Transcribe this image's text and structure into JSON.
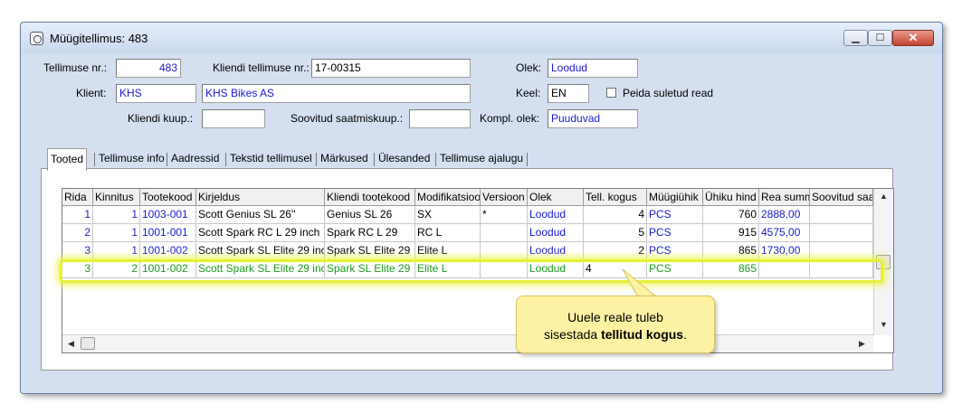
{
  "window": {
    "title": "Müügitellimus: 483"
  },
  "form": {
    "order_no_label": "Tellimuse nr.:",
    "order_no": "483",
    "client_order_label": "Kliendi tellimuse nr.:",
    "client_order": "17-00315",
    "status_label": "Olek:",
    "status": "Loodud",
    "client_label": "Klient:",
    "client_code": "KHS",
    "client_name": "KHS Bikes AS",
    "lang_label": "Keel:",
    "lang": "EN",
    "hide_closed_label": "Peida suletud read",
    "client_date_label": "Kliendi kuup.:",
    "client_date": "",
    "desired_date_label": "Soovitud saatmiskuup.:",
    "desired_date": "",
    "compl_status_label": "Kompl. olek:",
    "compl_status": "Puuduvad"
  },
  "tabs": [
    "Tooted",
    "Tellimuse info",
    "Aadressid",
    "Tekstid tellimusel",
    "Märkused",
    "Ülesanded",
    "Tellimuse ajalugu"
  ],
  "table": {
    "columns": [
      "Rida",
      "Kinnitus",
      "Tootekood",
      "Kirjeldus",
      "Kliendi tootekood",
      "Modifikatsioo",
      "Versioon",
      "Olek",
      "Tell. kogus",
      "Müügiühik",
      "Ühiku hind",
      "Rea summ",
      "Soovitud saa"
    ],
    "rows": [
      [
        "1",
        "1",
        "1003-001",
        "Scott Genius SL 26''",
        "Genius SL 26",
        "SX",
        "*",
        "Loodud",
        "4",
        "PCS",
        "760",
        "2888,00",
        ""
      ],
      [
        "2",
        "1",
        "1001-001",
        "Scott Spark RC L 29 inch",
        "Spark RC L 29",
        "RC L",
        "",
        "Loodud",
        "5",
        "PCS",
        "915",
        "4575,00",
        ""
      ],
      [
        "3",
        "1",
        "1001-002",
        "Scott Spark SL Elite 29 inc",
        "Spark SL Elite 29",
        "Elite L",
        "",
        "Loodud",
        "2",
        "PCS",
        "865",
        "1730,00",
        ""
      ],
      [
        "3",
        "2",
        "1001-002",
        "Scott Spark SL Elite 29 inc",
        "Spark SL Elite 29",
        "Elite L",
        "",
        "Loodud",
        "4",
        "PCS",
        "865",
        "",
        ""
      ]
    ]
  },
  "callout": {
    "line1": "Uuele reale tuleb",
    "line2_pre": "sisestada ",
    "line2_bold": "tellitud kogus",
    "line2_post": "."
  },
  "colors": {
    "link_blue": "#1a1ad6",
    "new_row_green": "#1e9b1e",
    "highlight": "#e6ef3a",
    "callout_bg": "#fdf2a4"
  }
}
